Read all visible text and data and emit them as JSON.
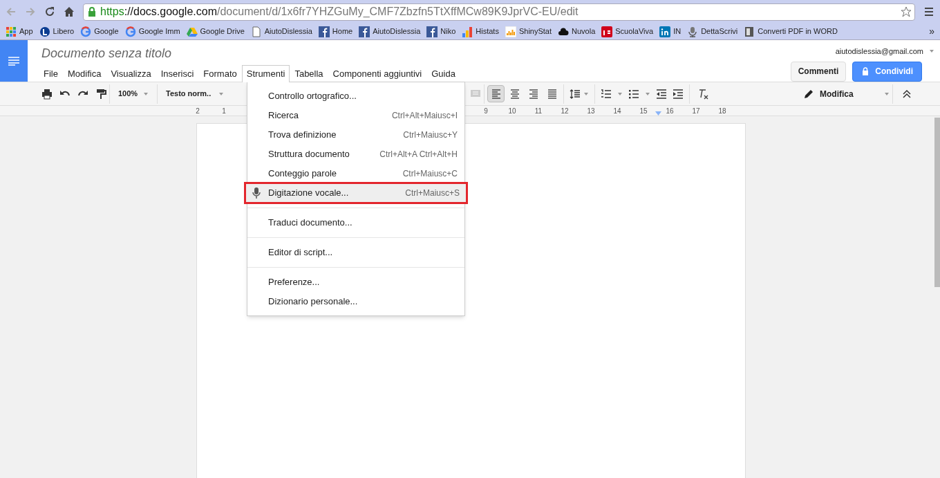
{
  "browser": {
    "url_scheme": "https",
    "url_host": "://docs.google.com",
    "url_path": "/document/d/1x6fr7YHZGuMy_CMF7Zbzfn5TtXffMCw89K9JprVC-EU/edit",
    "bookmarks": [
      {
        "label": "App",
        "kind": "apps"
      },
      {
        "label": "Libero",
        "kind": "libero"
      },
      {
        "label": "Google",
        "kind": "google"
      },
      {
        "label": "Google Imm",
        "kind": "google"
      },
      {
        "label": "Google Drive",
        "kind": "drive"
      },
      {
        "label": "AiutoDislessia",
        "kind": "page"
      },
      {
        "label": "Home",
        "kind": "facebook"
      },
      {
        "label": "AiutoDislessia",
        "kind": "facebook"
      },
      {
        "label": "Niko",
        "kind": "facebook"
      },
      {
        "label": "Histats",
        "kind": "bars"
      },
      {
        "label": "ShinyStat",
        "kind": "shiny"
      },
      {
        "label": "Nuvola",
        "kind": "cloud"
      },
      {
        "label": "ScuolaViva",
        "kind": "is"
      },
      {
        "label": "IN",
        "kind": "linkedin"
      },
      {
        "label": "DettaScrivi",
        "kind": "mic"
      },
      {
        "label": "Converti PDF in WORD",
        "kind": "pdf"
      }
    ],
    "more": "»"
  },
  "docs": {
    "title": "Documento senza titolo",
    "account": "aiutodislessia@gmail.com",
    "menus": [
      {
        "label": "File",
        "selected": false
      },
      {
        "label": "Modifica",
        "selected": false
      },
      {
        "label": "Visualizza",
        "selected": false
      },
      {
        "label": "Inserisci",
        "selected": false
      },
      {
        "label": "Formato",
        "selected": false
      },
      {
        "label": "Strumenti",
        "selected": true
      },
      {
        "label": "Tabella",
        "selected": false
      },
      {
        "label": "Componenti aggiuntivi",
        "selected": false
      },
      {
        "label": "Guida",
        "selected": false
      }
    ],
    "comments_button": "Commenti",
    "share_button": "Condividi"
  },
  "toolbar": {
    "zoom": "100%",
    "style": "Testo norm..",
    "alignment": [
      {
        "kind": "left",
        "selected": true
      },
      {
        "kind": "center",
        "selected": false
      },
      {
        "kind": "right",
        "selected": false
      },
      {
        "kind": "justify",
        "selected": false
      }
    ],
    "mode": "Modifica"
  },
  "ruler": {
    "left_labels": [
      "2",
      "1"
    ],
    "right_labels": [
      "9",
      "10",
      "11",
      "12",
      "13",
      "14",
      "15",
      "16",
      "17",
      "18"
    ]
  },
  "tools_menu": {
    "groups": [
      [
        {
          "label": "Controllo ortografico...",
          "highlighted": false
        },
        {
          "label": "Ricerca",
          "shortcut": "Ctrl+Alt+Maiusc+I",
          "highlighted": false
        },
        {
          "label": "Trova definizione",
          "shortcut": "Ctrl+Maiusc+Y",
          "highlighted": false
        },
        {
          "label": "Struttura documento",
          "shortcut": "Ctrl+Alt+A Ctrl+Alt+H",
          "highlighted": false
        },
        {
          "label": "Conteggio parole",
          "shortcut": "Ctrl+Maiusc+C",
          "highlighted": false
        },
        {
          "label": "Digitazione vocale...",
          "shortcut": "Ctrl+Maiusc+S",
          "highlighted": true,
          "kind": "voice"
        }
      ],
      [
        {
          "label": "Traduci documento...",
          "highlighted": false
        }
      ],
      [
        {
          "label": "Editor di script...",
          "highlighted": false
        }
      ],
      [
        {
          "label": "Preferenze...",
          "highlighted": false
        },
        {
          "label": "Dizionario personale...",
          "highlighted": false
        }
      ]
    ]
  }
}
